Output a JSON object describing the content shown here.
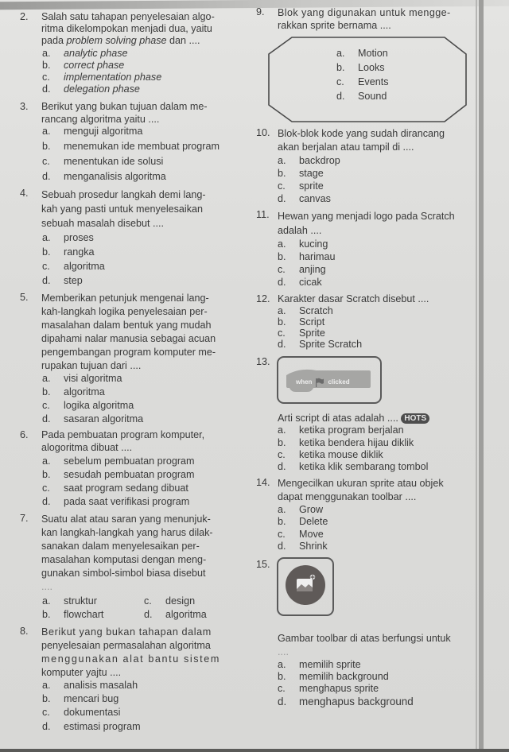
{
  "left_column": {
    "questions": [
      {
        "number": "2.",
        "text_lines": [
          "Salah satu tahapan penyelesaian algo-",
          "ritma dikelompokan menjadi dua, yaitu"
        ],
        "text_tail_prefix": "pada ",
        "text_tail_italic": "problem solving phase",
        "text_tail_suffix": " dan ....",
        "options": [
          {
            "letter": "a.",
            "text": "analytic phase"
          },
          {
            "letter": "b.",
            "text": "correct phase"
          },
          {
            "letter": "c.",
            "text": "implementation phase"
          },
          {
            "letter": "d.",
            "text": "delegation phase"
          }
        ]
      },
      {
        "number": "3.",
        "text_lines": [
          "Berikut yang bukan tujuan dalam me-",
          "rancang algoritma yaitu ...."
        ],
        "options": [
          {
            "letter": "a.",
            "text": "menguji algoritma"
          },
          {
            "letter": "b.",
            "text": "menemukan ide membuat program"
          },
          {
            "letter": "c.",
            "text": "menentukan ide solusi"
          },
          {
            "letter": "d.",
            "text": "menganalisis algoritma"
          }
        ]
      },
      {
        "number": "4.",
        "text_lines": [
          "Sebuah prosedur langkah demi lang-",
          "kah yang pasti untuk menyelesaikan",
          "sebuah masalah disebut ...."
        ],
        "options": [
          {
            "letter": "a.",
            "text": "proses"
          },
          {
            "letter": "b.",
            "text": "rangka"
          },
          {
            "letter": "c.",
            "text": "algoritma"
          },
          {
            "letter": "d.",
            "text": "step"
          }
        ]
      },
      {
        "number": "5.",
        "text_lines": [
          "Memberikan petunjuk mengenai lang-",
          "kah-langkah logika penyelesaian per-",
          "masalahan dalam bentuk yang mudah",
          "dipahami nalar manusia sebagai acuan",
          "pengembangan program komputer me-",
          "rupakan tujuan dari ...."
        ],
        "options": [
          {
            "letter": "a.",
            "text": "visi algoritma"
          },
          {
            "letter": "b.",
            "text": "algoritma"
          },
          {
            "letter": "c.",
            "text": "logika algoritma"
          },
          {
            "letter": "d.",
            "text": "sasaran algoritma"
          }
        ]
      },
      {
        "number": "6.",
        "text_lines": [
          "Pada pembuatan program komputer,",
          "alogoritma dibuat ...."
        ],
        "options": [
          {
            "letter": "a.",
            "text": "sebelum pembuatan program"
          },
          {
            "letter": "b.",
            "text": "sesudah pembuatan program"
          },
          {
            "letter": "c.",
            "text": "saat program sedang dibuat"
          },
          {
            "letter": "d.",
            "text": "pada saat verifikasi program"
          }
        ]
      },
      {
        "number": "7.",
        "text_lines": [
          "Suatu alat atau saran yang menunjuk-",
          "kan langkah-langkah yang harus dilak-",
          "sanakan dalam menyelesaikan per-",
          "masalahan komputasi dengan meng-",
          "gunakan simbol-simbol biasa disebut",
          "...."
        ],
        "options": [
          {
            "letter": "a.",
            "text": "struktur"
          },
          {
            "letter": "b.",
            "text": "flowchart"
          },
          {
            "letter": "c.",
            "text": "design"
          },
          {
            "letter": "d.",
            "text": "algoritma"
          }
        ]
      },
      {
        "number": "8.",
        "text_lines": [
          "Berikut yang bukan tahapan dalam",
          "penyelesaian permasalahan algoritma",
          "menggunakan alat bantu sistem",
          "komputer yajtu ...."
        ],
        "options": [
          {
            "letter": "a.",
            "text": "analisis masalah"
          },
          {
            "letter": "b.",
            "text": "mencari bug"
          },
          {
            "letter": "c.",
            "text": "dokumentasi"
          },
          {
            "letter": "d.",
            "text": "estimasi program"
          }
        ]
      }
    ]
  },
  "right_column": {
    "questions": [
      {
        "number": "9.",
        "text_lines": [
          "Blok yang digunakan untuk mengge-",
          "rakkan sprite bernama ...."
        ],
        "options": [
          {
            "letter": "a.",
            "text": "Motion"
          },
          {
            "letter": "b.",
            "text": "Looks"
          },
          {
            "letter": "c.",
            "text": "Events"
          },
          {
            "letter": "d.",
            "text": "Sound"
          }
        ]
      },
      {
        "number": "10.",
        "text_lines": [
          "Blok-blok kode yang sudah dirancang",
          "akan berjalan atau tampil di ...."
        ],
        "options": [
          {
            "letter": "a.",
            "text": "backdrop"
          },
          {
            "letter": "b.",
            "text": "stage"
          },
          {
            "letter": "c.",
            "text": "sprite"
          },
          {
            "letter": "d.",
            "text": "canvas"
          }
        ]
      },
      {
        "number": "11.",
        "text_lines": [
          "Hewan yang menjadi logo pada Scratch",
          "adalah ...."
        ],
        "options": [
          {
            "letter": "a.",
            "text": "kucing"
          },
          {
            "letter": "b.",
            "text": "harimau"
          },
          {
            "letter": "c.",
            "text": "anjing"
          },
          {
            "letter": "d.",
            "text": "cicak"
          }
        ]
      },
      {
        "number": "12.",
        "text_lines": [
          "Karakter dasar Scratch disebut ...."
        ],
        "options": [
          {
            "letter": "a.",
            "text": "Scratch"
          },
          {
            "letter": "b.",
            "text": "Script"
          },
          {
            "letter": "c.",
            "text": "Sprite"
          },
          {
            "letter": "d.",
            "text": "Sprite Scratch"
          }
        ]
      },
      {
        "number": "13.",
        "block": {
          "when": "when",
          "clicked": "clicked",
          "icon": "green-flag-icon"
        },
        "text_lines": [
          "Arti script di atas adalah ...."
        ],
        "badge": "HOTS",
        "options": [
          {
            "letter": "a.",
            "text": "ketika program berjalan"
          },
          {
            "letter": "b.",
            "text": "ketika bendera hijau diklik"
          },
          {
            "letter": "c.",
            "text": "ketika mouse diklik"
          },
          {
            "letter": "d.",
            "text": "ketika klik sembarang tombol"
          }
        ]
      },
      {
        "number": "14.",
        "text_lines": [
          "Mengecilkan ukuran sprite atau objek",
          "dapat menggunakan toolbar ...."
        ],
        "options": [
          {
            "letter": "a.",
            "text": "Grow"
          },
          {
            "letter": "b.",
            "text": "Delete"
          },
          {
            "letter": "c.",
            "text": "Move"
          },
          {
            "letter": "d.",
            "text": "Shrink"
          }
        ]
      },
      {
        "number": "15.",
        "toolbar_icon": "add-backdrop-icon",
        "text_lines": [
          "Gambar toolbar di atas berfungsi untuk",
          "...."
        ],
        "options": [
          {
            "letter": "a.",
            "text": "memilih sprite"
          },
          {
            "letter": "b.",
            "text": "memilih background"
          },
          {
            "letter": "c.",
            "text": "menghapus sprite"
          },
          {
            "letter": "d.",
            "text": "menghapus background"
          }
        ]
      }
    ]
  },
  "colors": {
    "paper": "#dedede",
    "ink": "#3a3a3a",
    "block_fill": "#a6a6a4",
    "badge": "#4d4d4d",
    "tool_button": "#5f5a58"
  }
}
